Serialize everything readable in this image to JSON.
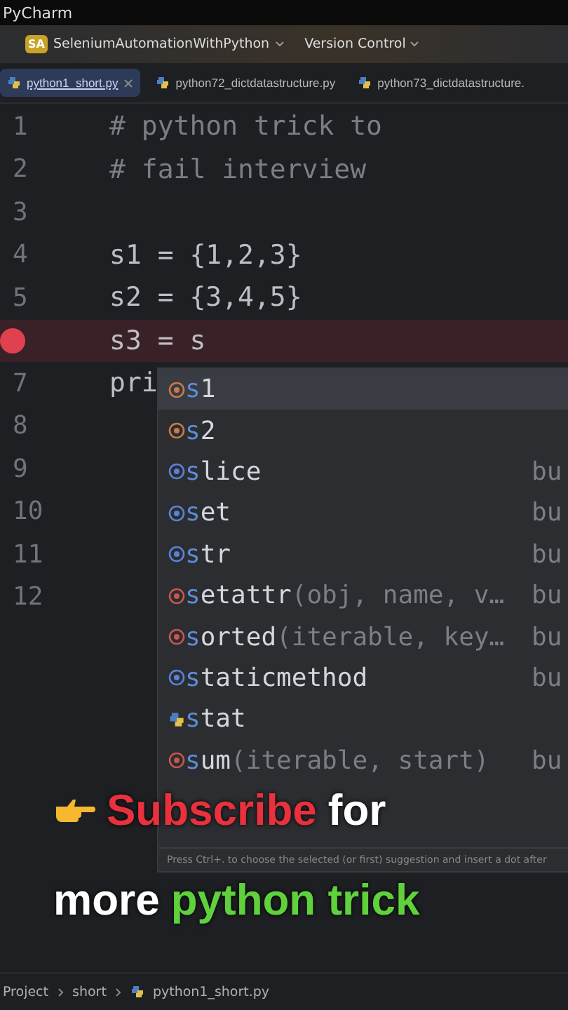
{
  "window": {
    "title": "PyCharm"
  },
  "toolbar": {
    "project": {
      "badge": "SA",
      "name": "SeleniumAutomationWithPython"
    },
    "vcs": "Version Control"
  },
  "tabs": [
    {
      "label": "python1_short.py",
      "selected": true
    },
    {
      "label": "python72_dictdatastructure.py",
      "selected": false
    },
    {
      "label": "python73_dictdatastructure.",
      "selected": false
    }
  ],
  "editor": {
    "lines": [
      {
        "number": "1",
        "code": "# python trick to",
        "kind": "comment",
        "breakpoint": false,
        "current": false
      },
      {
        "number": "2",
        "code": "# fail interview",
        "kind": "comment",
        "breakpoint": false,
        "current": false
      },
      {
        "number": "3",
        "breakpoint": false,
        "current": false
      },
      {
        "number": "4",
        "code": "s1 = {1,2,3}",
        "kind": "code",
        "breakpoint": false,
        "current": false
      },
      {
        "number": "5",
        "code": "s2 = {3,4,5}",
        "kind": "code",
        "breakpoint": false,
        "current": false
      },
      {
        "code": "s3 = s",
        "kind": "code",
        "breakpoint": true,
        "current": true
      },
      {
        "number": "7",
        "code": "pri",
        "kind": "code",
        "breakpoint": false,
        "current": false
      },
      {
        "number": "8",
        "breakpoint": false,
        "current": false
      },
      {
        "number": "9",
        "breakpoint": false,
        "current": false
      },
      {
        "number": "10",
        "breakpoint": false,
        "current": false
      },
      {
        "number": "11",
        "breakpoint": false,
        "current": false
      },
      {
        "number": "12",
        "breakpoint": false,
        "current": false
      }
    ]
  },
  "completion": {
    "items": [
      {
        "name": "s1",
        "kind": "variable",
        "selected": true
      },
      {
        "name": "s2",
        "kind": "variable",
        "selected": false
      },
      {
        "name": "slice",
        "kind": "class",
        "source": "bu",
        "selected": false
      },
      {
        "name": "set",
        "kind": "class",
        "source": "bu",
        "selected": false
      },
      {
        "name": "str",
        "kind": "class",
        "source": "bu",
        "selected": false
      },
      {
        "name": "setattr",
        "params": "(obj, name, v…",
        "kind": "function",
        "source": "bu",
        "selected": false
      },
      {
        "name": "sorted",
        "params": "(iterable, key…",
        "kind": "function",
        "source": "bu",
        "selected": false
      },
      {
        "name": "staticmethod",
        "kind": "class",
        "source": "bu",
        "selected": false
      },
      {
        "name": "stat",
        "kind": "module",
        "selected": false
      },
      {
        "name": "sum",
        "params": "(iterable, start)",
        "kind": "function",
        "source": "bu",
        "selected": false
      }
    ],
    "hint": "Press Ctrl+. to choose the selected (or first) suggestion and insert a dot after"
  },
  "caption": {
    "lines": [
      [
        {
          "text": "Subscribe",
          "kind": "highlight"
        },
        {
          "text": "for",
          "kind": "plain"
        }
      ],
      [
        {
          "text": "more",
          "kind": "plain"
        },
        {
          "text": "python trick",
          "kind": "accent"
        }
      ]
    ]
  },
  "breadcrumbs": [
    {
      "label": "Project",
      "kind": "folder"
    },
    {
      "label": "short",
      "kind": "folder"
    },
    {
      "label": "python1_short.py",
      "kind": "file"
    }
  ]
}
